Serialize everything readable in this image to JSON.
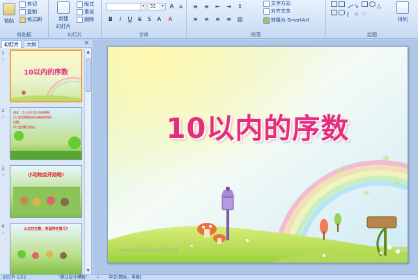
{
  "ribbon": {
    "clipboard": {
      "paste": "粘贴",
      "cut": "剪切",
      "copy": "复制",
      "format_painter": "格式刷",
      "group": "剪贴板"
    },
    "slides": {
      "new_slide": "新建",
      "new_slide2": "幻灯片",
      "layout": "版式",
      "reset": "重设",
      "delete": "删除",
      "group": "幻灯片"
    },
    "font": {
      "font_name": "",
      "font_size": "32",
      "group": "字体"
    },
    "paragraph": {
      "text_direction": "文字方向",
      "align_text": "对齐文本",
      "convert_smartart": "转换为 SmartArt",
      "group": "段落"
    },
    "drawing": {
      "arrange": "排列",
      "group": "绘图"
    }
  },
  "panel": {
    "tab_slides": "幻灯片",
    "tab_outline": "大纲",
    "close": "×",
    "slides": [
      {
        "num": "1",
        "star": "☆",
        "title": "10以内的序数"
      },
      {
        "num": "2",
        "star": "☆",
        "lines": [
          "要求：(1) 认识10以内的序数,",
          "(2) 会用序数词说出物体排列的",
          "位置。",
          "(3) 会用第几说出"
        ]
      },
      {
        "num": "3",
        "star": "☆",
        "title": "小动物会开始啦!"
      },
      {
        "num": "4",
        "star": "☆",
        "title": "从左往右数，老鼠排在第几?"
      }
    ]
  },
  "slide": {
    "title": "10以内的序数",
    "watermark": "www.zixuekaoshi.net"
  },
  "status": {
    "slide_info": "幻灯片 1/22",
    "theme": "\"默认设计模板\"",
    "language": "中文(简体，中国)"
  }
}
